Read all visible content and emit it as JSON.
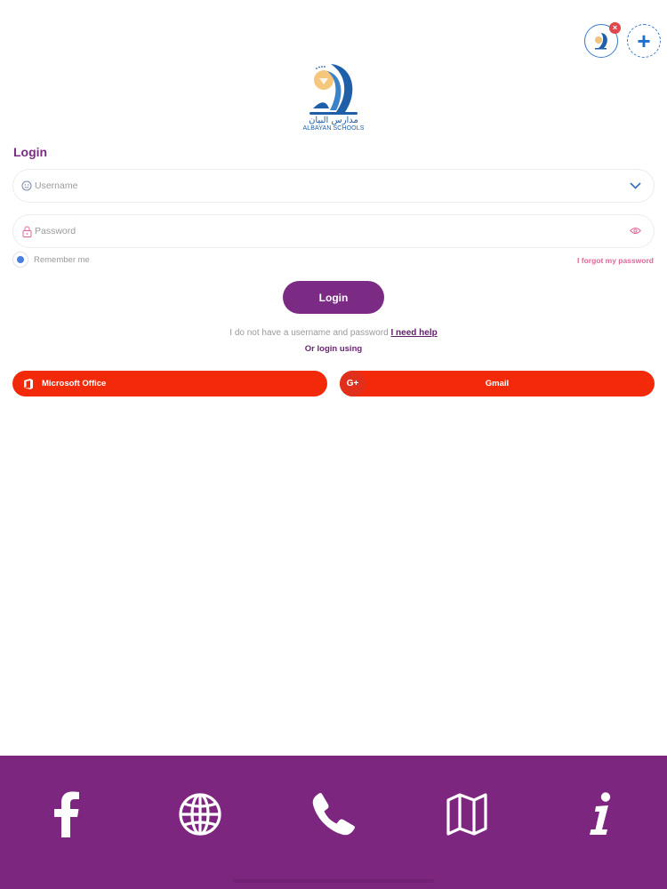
{
  "accounts": {
    "remove_glyph": "×",
    "add_glyph": "+"
  },
  "logo": {
    "arabic_text": "مدارس البيان",
    "english_text": "ALBAYAN SCHOOLS"
  },
  "login": {
    "title": "Login",
    "username_placeholder": "Username",
    "password_placeholder": "Password",
    "remember_label": "Remember me",
    "forgot_label": "I forgot my password",
    "login_button": "Login",
    "help_text": "I do not have a username and password",
    "help_link": "I need help",
    "or_login_using": "Or login using"
  },
  "social": {
    "microsoft_label": "Microsoft Office",
    "gmail_label": "Gmail",
    "gmail_icon_text": "G+"
  },
  "footer": {
    "icons": [
      "facebook-icon",
      "globe-icon",
      "phone-icon",
      "map-icon",
      "info-icon"
    ]
  },
  "colors": {
    "brand_purple": "#7b2b84",
    "social_red": "#f22a0a",
    "accent_blue": "#3a7bc8",
    "forgot_pink": "#e0679a"
  }
}
